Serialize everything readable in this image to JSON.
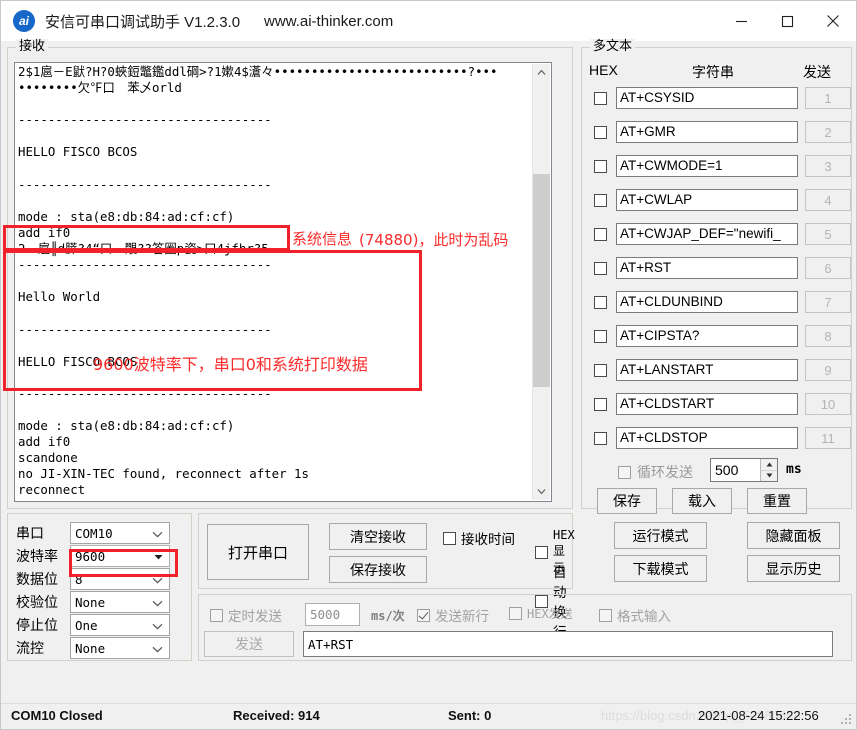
{
  "window": {
    "logo_text": "ai",
    "title": "安信可串口调试助手 V1.2.3.0",
    "url": "www.ai-thinker.com",
    "minimize_label": "minimize-icon",
    "maximize_label": "maximize-icon",
    "close_label": "close-icon"
  },
  "receive": {
    "group_label": "接收",
    "text": "2$1扈－E鼣?H?0蛺鋀鼈鑑ddl碙>?1嫰4$濸々••••••••••••••••••••••••••?•••\n••••••••欠℉口　苯乄orld\n\n----------------------------------\n\nHELLO FISCO BCOS\n\n----------------------------------\n\nmode : sta(e8:db:84:ad:cf:cf)\nadd if0\n2　扈╟d膵?4“口　覸??答圈p瓷>口4jfhr?5\n----------------------------------\n\nHello World\n\n----------------------------------\n\nHELLO FISCO BCOS\n\n----------------------------------\n\nmode : sta(e8:db:84:ad:cf:cf)\nadd if0\nscandone\nno JI-XIN-TEC found, reconnect after 1s\nreconnect"
  },
  "annotations": {
    "system_info_label": "系统信息",
    "system_info_note": "(74880)，此时为乱码",
    "inner_note": "9600波特率下，串口0和系统打印数据",
    "color": "#fb2b2b"
  },
  "multitext": {
    "group_label": "多文本",
    "col_hex": "HEX",
    "col_string": "字符串",
    "col_send": "发送",
    "rows": [
      {
        "hex_checked": false,
        "command": "AT+CSYSID",
        "send": "1"
      },
      {
        "hex_checked": false,
        "command": "AT+GMR",
        "send": "2"
      },
      {
        "hex_checked": false,
        "command": "AT+CWMODE=1",
        "send": "3"
      },
      {
        "hex_checked": false,
        "command": "AT+CWLAP",
        "send": "4"
      },
      {
        "hex_checked": false,
        "command": "AT+CWJAP_DEF=\"newifi_",
        "send": "5"
      },
      {
        "hex_checked": false,
        "command": "AT+RST",
        "send": "6"
      },
      {
        "hex_checked": false,
        "command": "AT+CLDUNBIND",
        "send": "7"
      },
      {
        "hex_checked": false,
        "command": "AT+CIPSTA?",
        "send": "8"
      },
      {
        "hex_checked": false,
        "command": "AT+LANSTART",
        "send": "9"
      },
      {
        "hex_checked": false,
        "command": "AT+CLDSTART",
        "send": "10"
      },
      {
        "hex_checked": false,
        "command": "AT+CLDSTOP",
        "send": "11"
      }
    ],
    "loop_send_label": "循环发送",
    "loop_send_checked": false,
    "loop_interval": "500",
    "loop_unit": "ms",
    "save_label": "保存",
    "load_label": "载入",
    "reset_label": "重置"
  },
  "serial": {
    "fields": [
      {
        "label": "串口",
        "value": "COM10"
      },
      {
        "label": "波特率",
        "value": "9600"
      },
      {
        "label": "数据位",
        "value": "8"
      },
      {
        "label": "校验位",
        "value": "None"
      },
      {
        "label": "停止位",
        "value": "One"
      },
      {
        "label": "流控",
        "value": "None"
      }
    ]
  },
  "actions": {
    "open_port": "打开串口",
    "clear_receive": "清空接收",
    "save_receive": "保存接收",
    "recv_time_label": "接收时间",
    "recv_time_checked": false,
    "hex_display_label": "HEX显示",
    "hex_display_checked": false,
    "auto_wrap_label": "自动换行",
    "auto_wrap_checked": false,
    "run_mode": "运行模式",
    "download_mode": "下载模式",
    "hide_panel": "隐藏面板",
    "show_history": "显示历史"
  },
  "send_panel": {
    "timed_send_label": "定时发送",
    "timed_send_checked": false,
    "timed_interval": "5000",
    "interval_unit": "ms/次",
    "send_newline_label": "发送新行",
    "send_newline_checked": true,
    "hex_send_label": "HEX发送",
    "hex_send_checked": false,
    "format_input_label": "格式输入",
    "format_input_checked": false,
    "send_button": "发送",
    "send_text": "AT+RST"
  },
  "statusbar": {
    "connection": "COM10 Closed",
    "received": "Received: 914",
    "sent": "Sent: 0",
    "timestamp": "2021-08-24 15:22:56",
    "watermark": "https://blog.csdn.net/qq_50980658"
  }
}
